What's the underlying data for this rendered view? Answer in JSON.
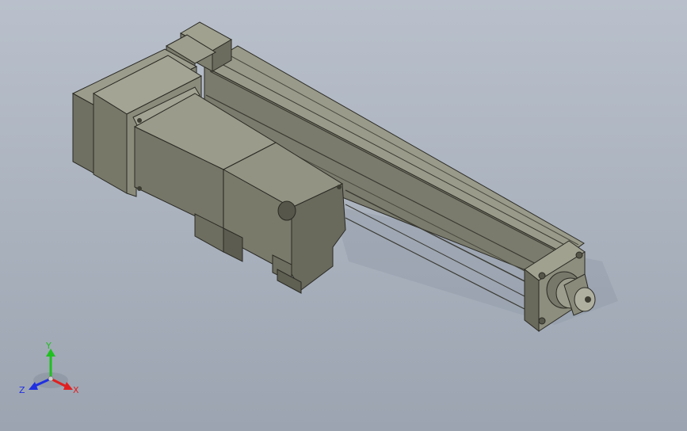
{
  "viewport": {
    "background_top": "#b9c0cb",
    "background_bottom": "#9ca4b1"
  },
  "model": {
    "name": "electric-linear-actuator-with-motor",
    "body_color": "#8c8c7c",
    "body_dark": "#5f5f52",
    "body_light": "#a8a899",
    "edge_color": "#2a2a24"
  },
  "triad": {
    "x_label": "X",
    "y_label": "Y",
    "z_label": "Z",
    "x_color": "#e02020",
    "y_color": "#20c020",
    "z_color": "#2030e0"
  }
}
